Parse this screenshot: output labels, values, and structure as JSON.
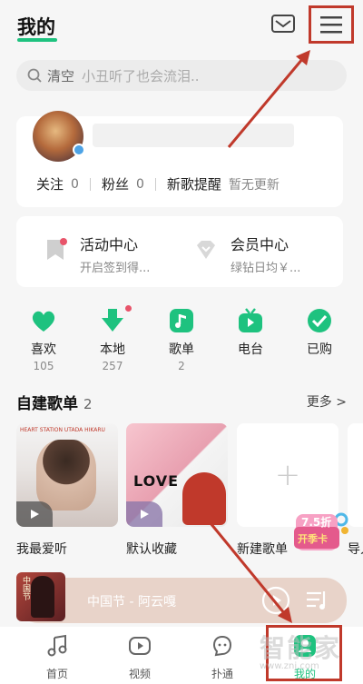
{
  "header": {
    "title": "我的"
  },
  "search": {
    "label": "清空",
    "placeholder": "小丑听了也会流泪.."
  },
  "profile": {
    "stats": [
      {
        "label": "关注",
        "value": "0"
      },
      {
        "label": "粉丝",
        "value": "0"
      },
      {
        "label": "新歌提醒",
        "value": "暂无更新"
      }
    ]
  },
  "services": [
    {
      "title": "活动中心",
      "subtitle": "开启签到得..."
    },
    {
      "title": "会员中心",
      "subtitle": "绿钻日均￥..."
    }
  ],
  "quick": [
    {
      "label": "喜欢",
      "count": "105",
      "icon": "heart-icon"
    },
    {
      "label": "本地",
      "count": "257",
      "icon": "download-icon"
    },
    {
      "label": "歌单",
      "count": "2",
      "icon": "music-note-icon"
    },
    {
      "label": "电台",
      "count": "",
      "icon": "radio-tv-icon"
    },
    {
      "label": "已购",
      "count": "",
      "icon": "check-icon"
    }
  ],
  "playlists": {
    "heading": "自建歌单",
    "count": "2",
    "more": "更多 >",
    "items": [
      {
        "name": "我最爱听",
        "cover_text": "HEART STATION  UTADA HIKARU"
      },
      {
        "name": "默认收藏",
        "cover_text": "LOVE"
      },
      {
        "name": "新建歌单",
        "cover_text": "+"
      },
      {
        "name": "导入"
      }
    ]
  },
  "promo": {
    "discount": "7.5折",
    "label": "开季卡"
  },
  "player": {
    "song": "中国节 - 阿云嘎",
    "art_text": "中国节"
  },
  "tabs": [
    {
      "label": "首页",
      "icon": "music-note-icon"
    },
    {
      "label": "视频",
      "icon": "video-play-icon"
    },
    {
      "label": "扑通",
      "icon": "chat-face-icon"
    },
    {
      "label": "我的",
      "icon": "profile-icon"
    }
  ],
  "watermark": {
    "text": "智能家",
    "sub": "www.znj.com"
  },
  "colors": {
    "accent": "#1ec27f",
    "highlight": "#c0392b",
    "reddot": "#e8546a"
  }
}
